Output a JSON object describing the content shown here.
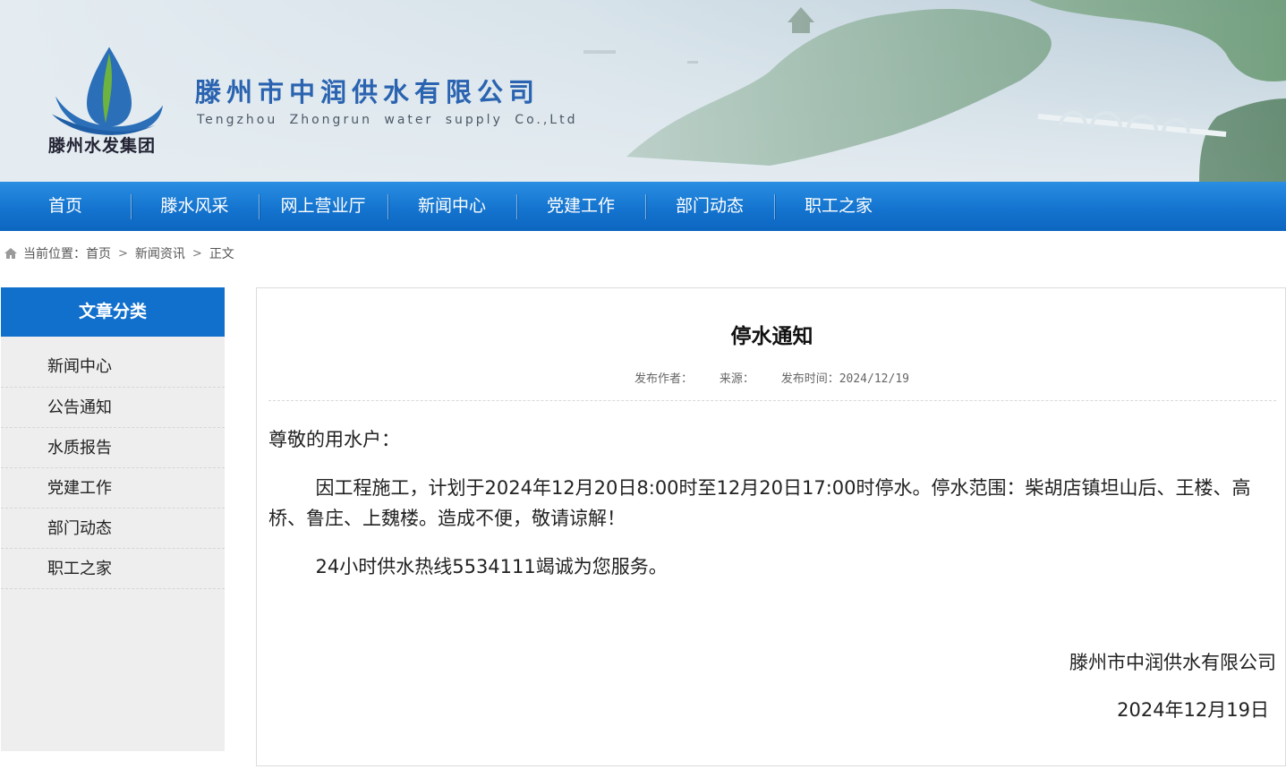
{
  "header": {
    "company_cn": "滕州市中润供水有限公司",
    "company_en": "Tengzhou Zhongrun water supply Co.,Ltd",
    "group_name": "滕州水发集团"
  },
  "nav": {
    "items": [
      {
        "label": "首页"
      },
      {
        "label": "滕水风采"
      },
      {
        "label": "网上营业厅"
      },
      {
        "label": "新闻中心"
      },
      {
        "label": "党建工作"
      },
      {
        "label": "部门动态"
      },
      {
        "label": "职工之家"
      }
    ]
  },
  "breadcrumb": {
    "prefix": "当前位置：",
    "items": [
      "首页",
      "新闻资讯",
      "正文"
    ]
  },
  "sidebar": {
    "title": "文章分类",
    "items": [
      {
        "label": "新闻中心"
      },
      {
        "label": "公告通知"
      },
      {
        "label": "水质报告"
      },
      {
        "label": "党建工作"
      },
      {
        "label": "部门动态"
      },
      {
        "label": "职工之家"
      }
    ]
  },
  "article": {
    "title": "停水通知",
    "meta": {
      "author_label": "发布作者：",
      "source_label": "来源：",
      "time_label": "发布时间：2024/12/19"
    },
    "greeting": "尊敬的用水户：",
    "paragraph1": "因工程施工，计划于2024年12月20日8:00时至12月20日17:00时停水。停水范围：柴胡店镇坦山后、王楼、高桥、鲁庄、上魏楼。造成不便，敬请谅解！",
    "paragraph2": "24小时供水热线5534111竭诚为您服务。",
    "signature": "滕州市中润供水有限公司",
    "date": "2024年12月19日"
  },
  "colors": {
    "nav_blue": "#1474cf",
    "sidebar_head": "#1170cc",
    "brand_blue": "#2a63b0"
  }
}
